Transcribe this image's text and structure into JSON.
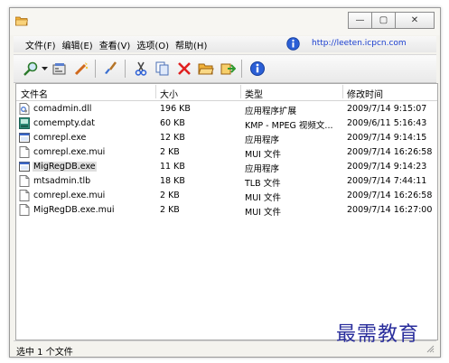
{
  "window": {
    "minimize_glyph": "—",
    "maximize_glyph": "▢",
    "close_glyph": "✕"
  },
  "menu": {
    "items": [
      "文件(F)",
      "编辑(E)",
      "查看(V)",
      "选项(O)",
      "帮助(H)"
    ],
    "url": "http://leeten.icpcn.com"
  },
  "toolbar": {
    "icons": [
      "find-icon",
      "dropdown-arrow-icon",
      "properties-icon",
      "wand-icon",
      "brush-icon",
      "cut-icon",
      "copy-icon",
      "delete-icon",
      "open-folder-icon",
      "export-icon",
      "info-icon"
    ]
  },
  "columns": [
    "文件名",
    "大小",
    "类型",
    "修改时间"
  ],
  "files": [
    {
      "name": "comadmin.dll",
      "size": "196 KB",
      "type": "应用程序扩展",
      "modified": "2009/7/14  9:15:07",
      "icon": "dll-icon"
    },
    {
      "name": "comempty.dat",
      "size": "60 KB",
      "type": "KMP - MPEG 视频文...",
      "modified": "2009/6/11  5:16:43",
      "icon": "dat-icon"
    },
    {
      "name": "comrepl.exe",
      "size": "12 KB",
      "type": "应用程序",
      "modified": "2009/7/14  9:14:15",
      "icon": "exe-icon"
    },
    {
      "name": "comrepl.exe.mui",
      "size": "2 KB",
      "type": "MUI 文件",
      "modified": "2009/7/14  16:26:58",
      "icon": "file-icon"
    },
    {
      "name": "MigRegDB.exe",
      "size": "11 KB",
      "type": "应用程序",
      "modified": "2009/7/14  9:14:23",
      "icon": "exe-icon"
    },
    {
      "name": "mtsadmin.tlb",
      "size": "18 KB",
      "type": "TLB 文件",
      "modified": "2009/7/14  7:44:11",
      "icon": "file-icon"
    },
    {
      "name": "comrepl.exe.mui",
      "size": "2 KB",
      "type": "MUI 文件",
      "modified": "2009/7/14  16:26:58",
      "icon": "file-icon"
    },
    {
      "name": "MigRegDB.exe.mui",
      "size": "2 KB",
      "type": "MUI 文件",
      "modified": "2009/7/14  16:27:00",
      "icon": "file-icon"
    }
  ],
  "status": "选中 1 个文件",
  "watermark": "最需教育",
  "colors": {
    "url": "#1a3ecf",
    "watermark": "#2a2e9c",
    "delete": "#e02020"
  }
}
